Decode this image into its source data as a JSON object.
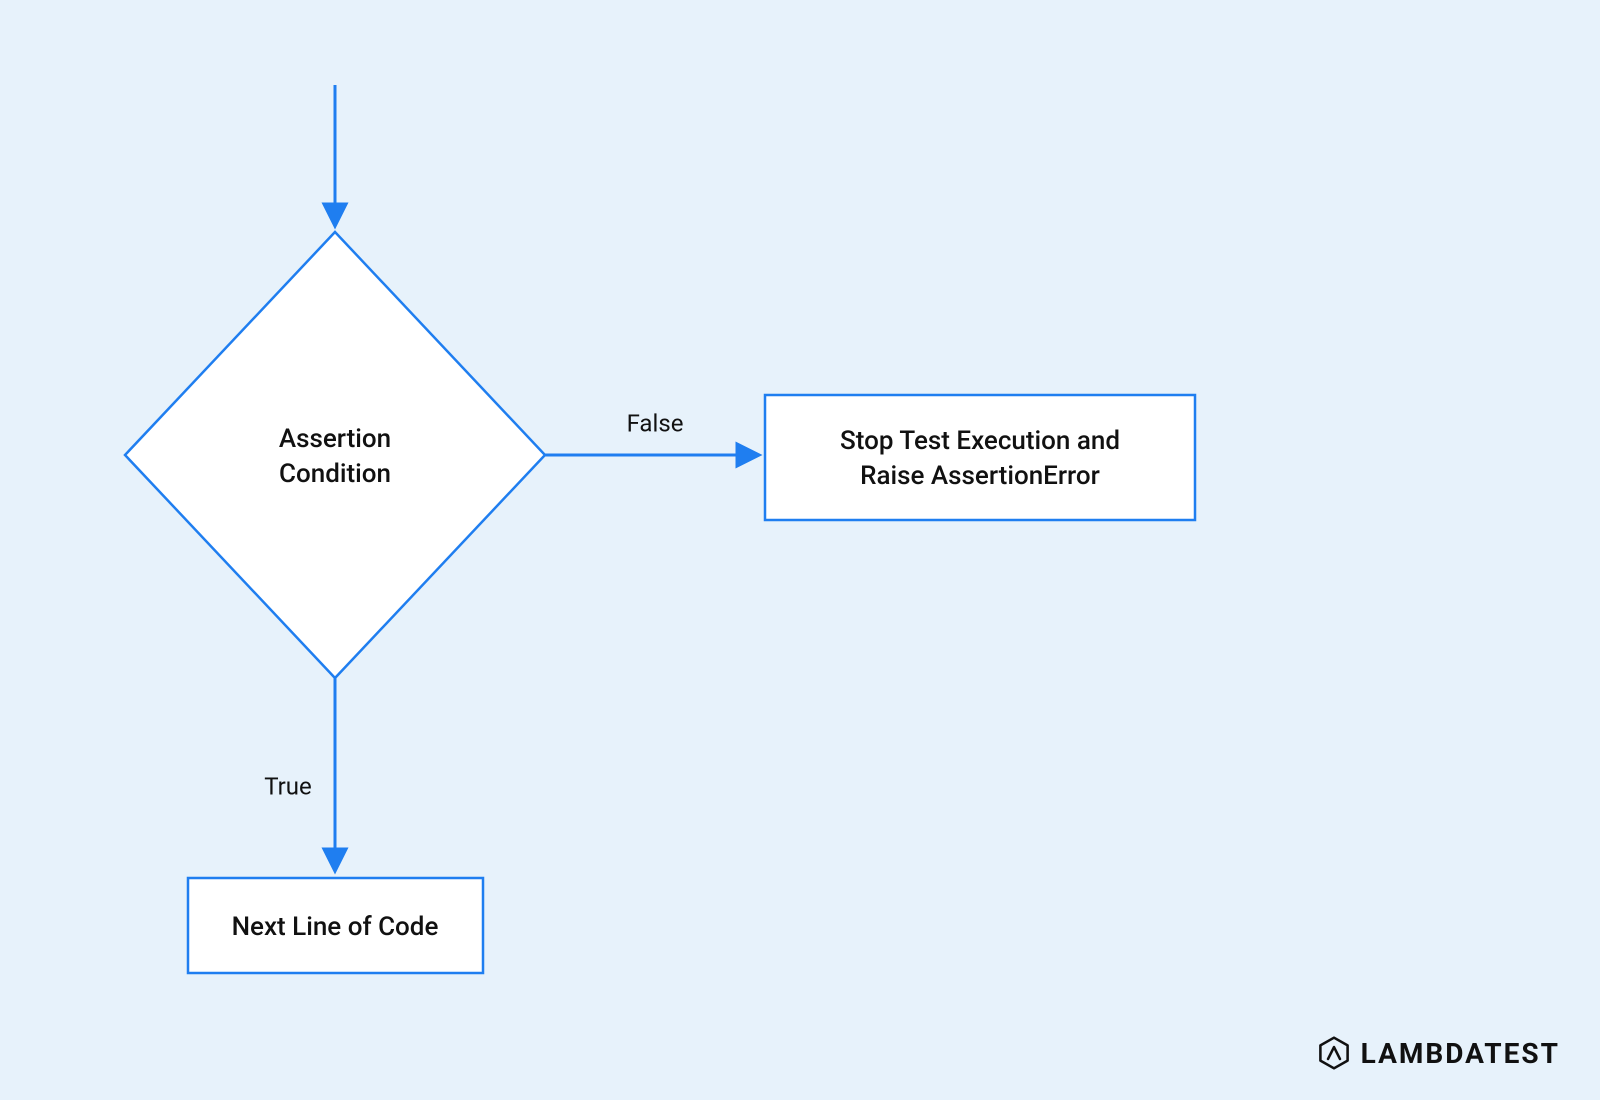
{
  "colors": {
    "bg": "#e7f2fb",
    "stroke": "#1f7ef0",
    "nodeFill": "#ffffff",
    "text": "#111111"
  },
  "nodes": {
    "decision": {
      "line1": "Assertion",
      "line2": "Condition"
    },
    "falseBox": {
      "line1": "Stop Test Execution and",
      "line2": "Raise AssertionError"
    },
    "trueBox": {
      "line1": "Next Line of Code"
    }
  },
  "edges": {
    "falseLabel": "False",
    "trueLabel": "True"
  },
  "brand": "LAMBDATEST"
}
